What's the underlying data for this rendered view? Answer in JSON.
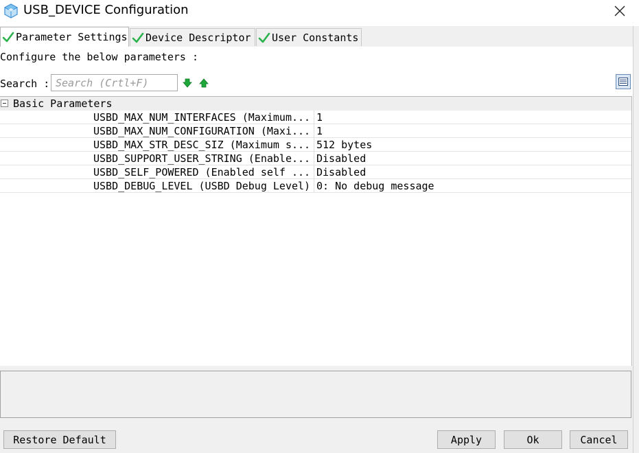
{
  "window": {
    "title": "USB_DEVICE Configuration",
    "icon": "cube-icon",
    "close_icon": "close-icon"
  },
  "tabs": [
    {
      "label": "Parameter Settings",
      "icon": "check-icon",
      "active": true
    },
    {
      "label": "Device Descriptor",
      "icon": "check-icon",
      "active": false
    },
    {
      "label": "User Constants",
      "icon": "check-icon",
      "active": false
    }
  ],
  "main": {
    "configure_label": "Configure the below parameters :",
    "search_label": "Search :",
    "search_placeholder": "Search (Crtl+F)",
    "search_value": "",
    "down_arrow_icon": "arrow-down-icon",
    "up_arrow_icon": "arrow-up-icon",
    "view_toggle_icon": "list-view-icon"
  },
  "table": {
    "group": {
      "label": "Basic Parameters",
      "expanded": true
    },
    "rows": [
      {
        "name": "USBD_MAX_NUM_INTERFACES (Maximum...",
        "value": "1"
      },
      {
        "name": "USBD_MAX_NUM_CONFIGURATION (Maxi...",
        "value": "1"
      },
      {
        "name": "USBD_MAX_STR_DESC_SIZ (Maximum s...",
        "value": "512 bytes"
      },
      {
        "name": "USBD_SUPPORT_USER_STRING (Enable...",
        "value": "Disabled"
      },
      {
        "name": "USBD_SELF_POWERED (Enabled self ...",
        "value": "Disabled"
      },
      {
        "name": "USBD_DEBUG_LEVEL (USBD Debug Level)",
        "value": "0: No debug message"
      }
    ]
  },
  "footer": {
    "restore_default": "Restore Default",
    "apply": "Apply",
    "ok": "Ok",
    "cancel": "Cancel"
  },
  "colors": {
    "check_green": "#2bb24c",
    "arrow_green": "#1fa83a",
    "icon_blue": "#3a8fd6"
  }
}
